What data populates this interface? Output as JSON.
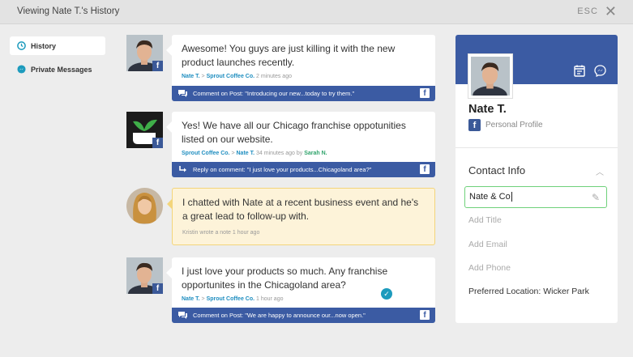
{
  "header": {
    "title": "Viewing Nate T.'s History",
    "esc_label": "ESC"
  },
  "sidebar": {
    "items": [
      {
        "label": "History",
        "icon": "clock-icon",
        "active": true
      },
      {
        "label": "Private Messages",
        "icon": "messenger-icon",
        "active": false
      }
    ]
  },
  "feed": [
    {
      "message": "Awesome! You guys are just killing it with the new product launches recently.",
      "author": "Nate T.",
      "sep": ">",
      "target": "Sprout Coffee Co.",
      "time": "2 minutes ago",
      "action": "Comment on Post: \"Introducing our new...today to try them.\""
    },
    {
      "message": "Yes! We have all our Chicago franchise oppotunities listed on our website.",
      "author": "Sprout Coffee Co.",
      "sep": ">",
      "target": "Nate T.",
      "time": "34 minutes ago",
      "by_prefix": "by",
      "by": "Sarah N.",
      "action": "Reply on comment: \"I just love your products...Chicagoland area?\""
    },
    {
      "message": "I chatted with Nate at a recent business event and he's a great lead to follow-up with.",
      "note_meta": "Kristin wrote a note 1 hour ago"
    },
    {
      "message": "I just love your products so much. Any franchise opportunites in the Chicagoland area?",
      "author": "Nate T.",
      "sep": ">",
      "target": "Sprout Coffee Co.",
      "time": "1 hour ago",
      "action": "Comment on Post: \"We are happy to announce our...now open.\""
    }
  ],
  "profile": {
    "name": "Nate T.",
    "type": "Personal Profile",
    "section_title": "Contact Info",
    "company_value": "Nate & Co",
    "title_placeholder": "Add Title",
    "email_placeholder": "Add Email",
    "phone_placeholder": "Add Phone",
    "preferred_label": "Preferred Location:",
    "preferred_value": "Wicker Park"
  },
  "colors": {
    "facebook": "#3b5ba3",
    "accent_green": "#6fd17a",
    "link_blue": "#1f8ec0",
    "note_bg": "#fdf3d9"
  }
}
